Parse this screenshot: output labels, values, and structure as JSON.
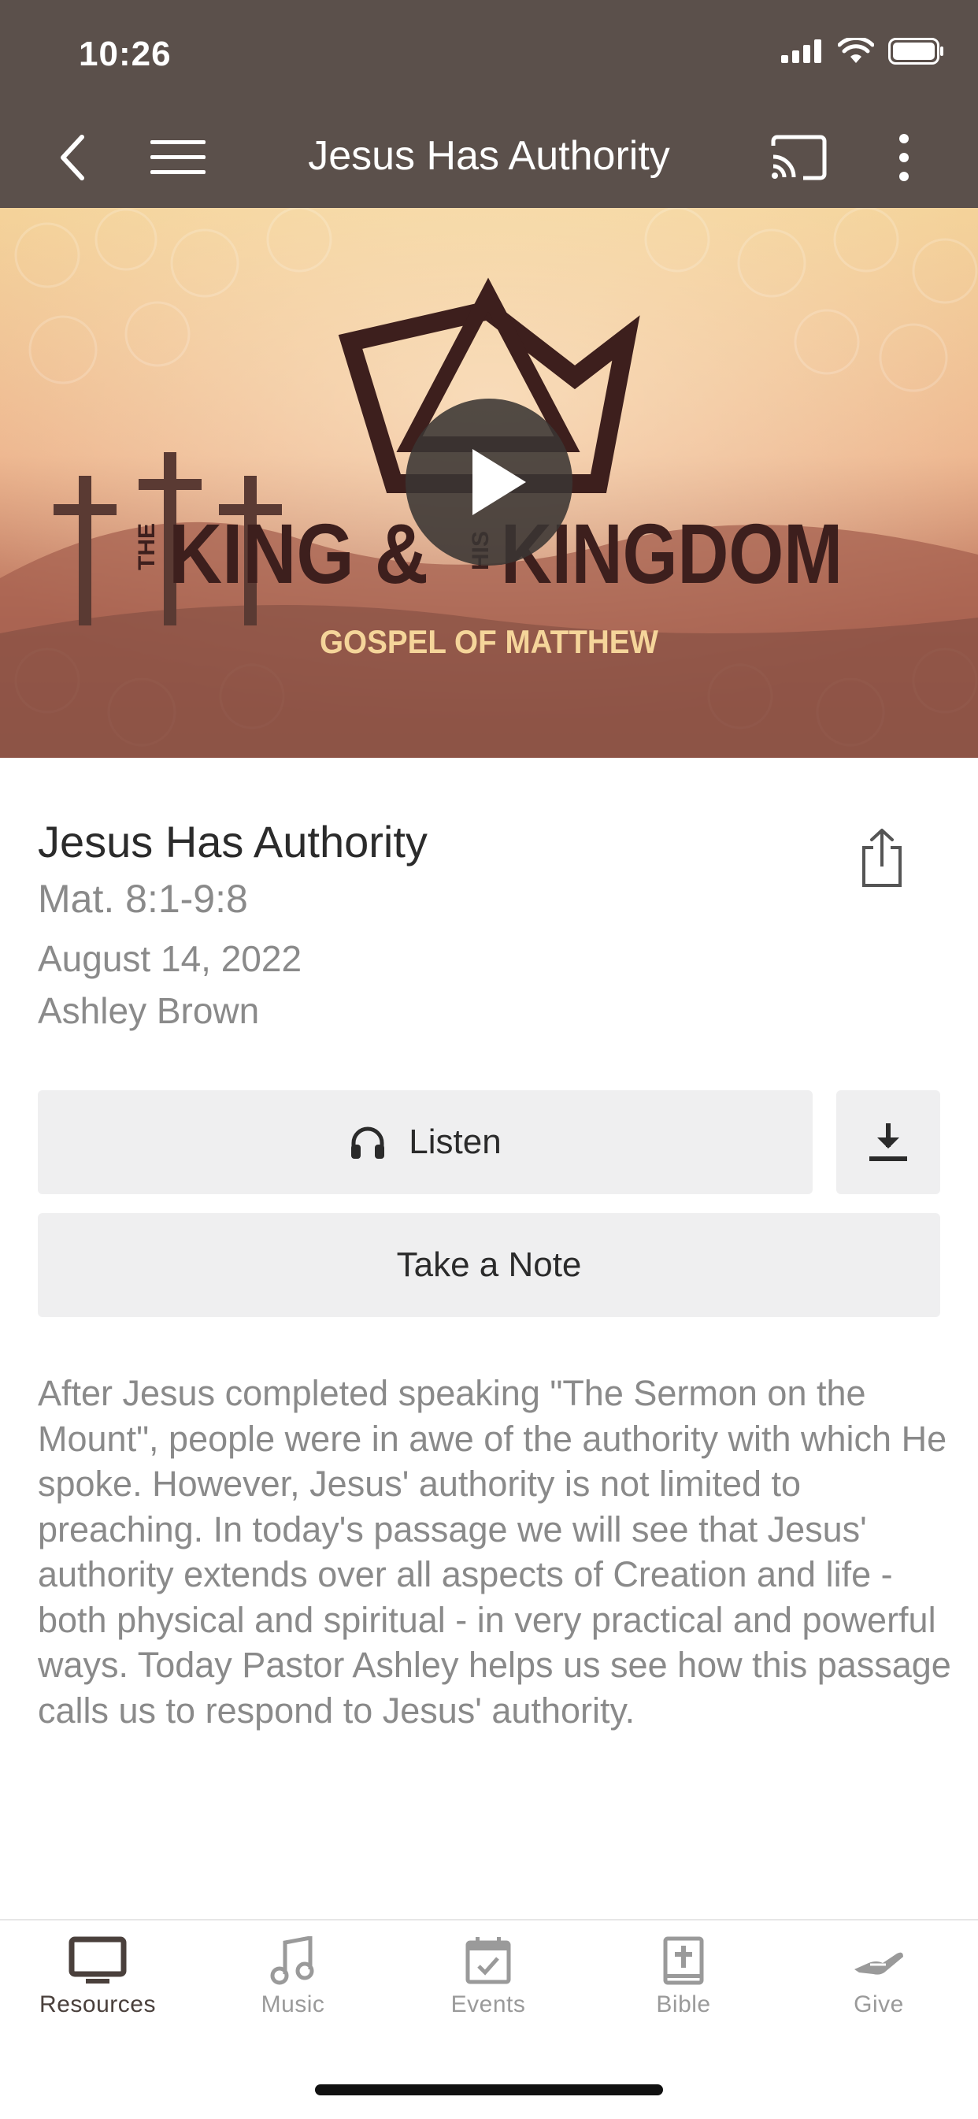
{
  "status_bar": {
    "time": "10:26"
  },
  "nav": {
    "title": "Jesus Has Authority"
  },
  "hero": {
    "logo_text_main_left": "KING &",
    "logo_text_main_right": "KINGDOM",
    "logo_text_small_left": "THE",
    "logo_text_small_right": "HIS",
    "subtitle": "GOSPEL OF MATTHEW"
  },
  "sermon": {
    "title": "Jesus Has Authority",
    "scripture": "Mat. 8:1-9:8",
    "date": "August 14, 2022",
    "speaker": "Ashley Brown",
    "description": "After Jesus completed speaking \"The Sermon on the Mount\", people were in awe of the authority with which He spoke. However, Jesus' authority is not limited to preaching. In today's passage we will see that Jesus' authority extends over all aspects of Creation and life - both physical and spiritual - in very practical and powerful ways. Today Pastor Ashley helps us see how this passage calls us to respond to Jesus' authority."
  },
  "actions": {
    "listen_label": "Listen",
    "note_label": "Take a Note"
  },
  "tabs": [
    {
      "label": "Resources",
      "icon": "monitor-icon",
      "active": true
    },
    {
      "label": "Music",
      "icon": "music-note-icon",
      "active": false
    },
    {
      "label": "Events",
      "icon": "calendar-check-icon",
      "active": false
    },
    {
      "label": "Bible",
      "icon": "bible-icon",
      "active": false
    },
    {
      "label": "Give",
      "icon": "giving-hand-icon",
      "active": false
    }
  ],
  "colors": {
    "header": "#5b504b",
    "button_bg": "#efeff0",
    "muted_text": "#8a8a8a",
    "active_tab": "#4a403c"
  }
}
